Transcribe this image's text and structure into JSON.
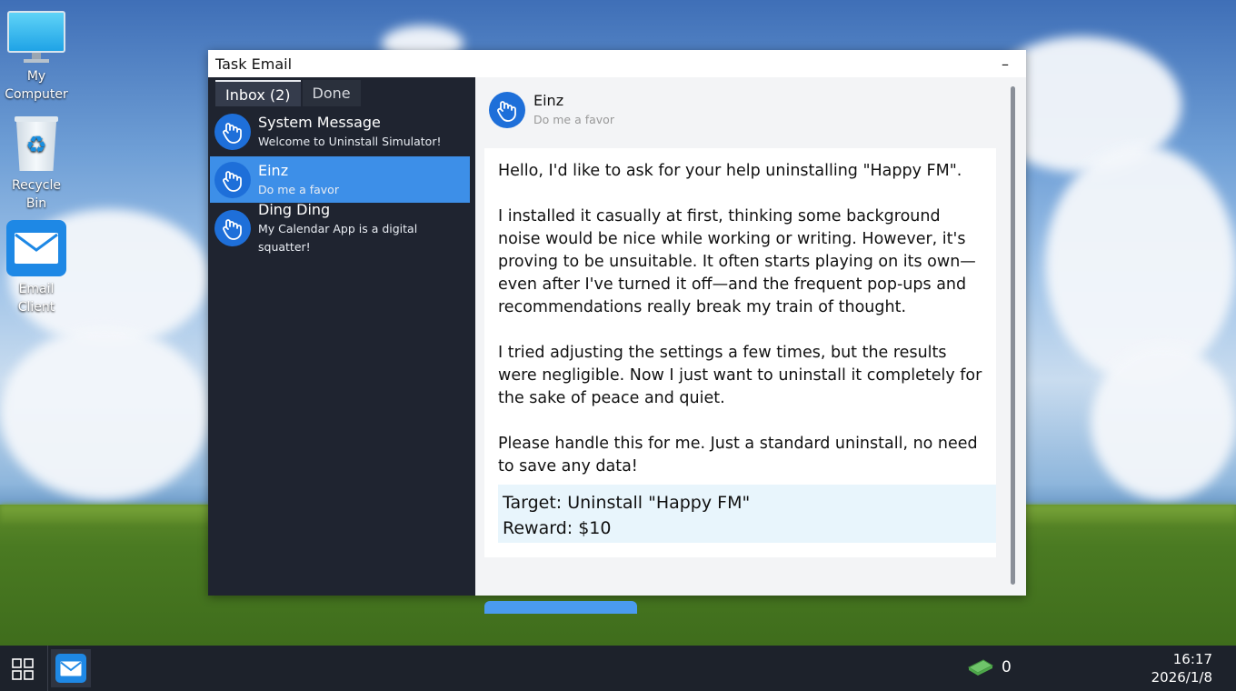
{
  "desktop": {
    "icons": [
      {
        "label": "My Computer"
      },
      {
        "label": "Recycle Bin"
      },
      {
        "label": "Email Client"
      }
    ]
  },
  "window": {
    "title": "Task Email",
    "minimize_label": "–"
  },
  "sidebar": {
    "tabs": [
      {
        "label": "Inbox (2)"
      },
      {
        "label": "Done"
      }
    ],
    "mails": [
      {
        "from": "System Message",
        "subject": "Welcome to Uninstall Simulator!"
      },
      {
        "from": "Einz",
        "subject": "Do me a favor"
      },
      {
        "from": "Ding Ding",
        "subject": "My Calendar App is a digital squatter!"
      }
    ]
  },
  "message": {
    "from": "Einz",
    "subject": "Do me a favor",
    "paragraphs": [
      "Hello, I'd like to ask for your help uninstalling \"Happy FM\".",
      "I installed it casually at first, thinking some background noise would be nice while working or writing. However, it's proving to be unsuitable. It often starts playing on its own—even after I've turned it off—and the frequent pop-ups and recommendations really break my train of thought.",
      "I tried adjusting the settings a few times, but the results were negligible. Now I just want to uninstall it completely for the sake of peace and quiet.",
      "Please handle this for me. Just a standard uninstall, no need to save any data!"
    ],
    "target": "Target: Uninstall \"Happy FM\"",
    "reward": "Reward: $10"
  },
  "taskbar": {
    "money": "0",
    "time": "16:17",
    "date": "2026/1/8"
  },
  "colors": {
    "selected": "#3d8fe8",
    "sidebar_bg": "#1f2430",
    "avatar": "#1e6fd9",
    "taskbar": "#1d222b"
  }
}
